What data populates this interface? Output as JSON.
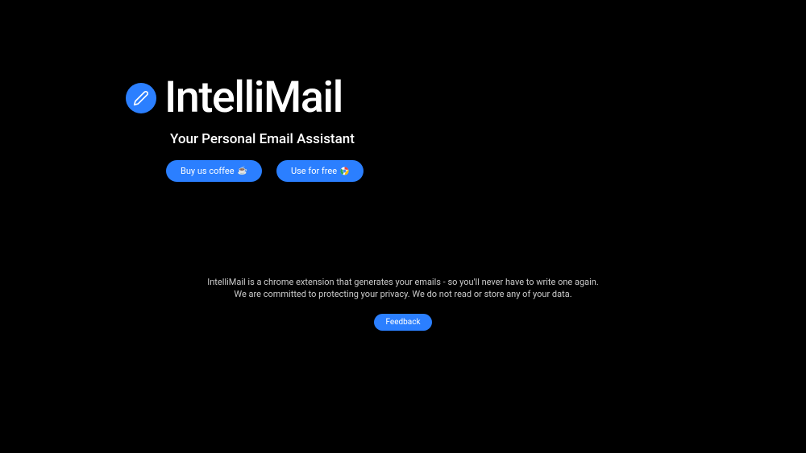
{
  "hero": {
    "title": "IntelliMail",
    "subtitle": "Your Personal Email Assistant"
  },
  "buttons": {
    "coffee_label": "Buy us coffee",
    "coffee_emoji": "☕",
    "use_free_label": "Use for free",
    "feedback_label": "Feedback"
  },
  "footer": {
    "line1": "IntelliMail is a chrome extension that generates your emails - so you'll never have to write one again.",
    "line2": "We are committed to protecting your privacy. We do not read or store any of your data."
  },
  "colors": {
    "accent": "#2B7FFF",
    "background": "#000000"
  }
}
